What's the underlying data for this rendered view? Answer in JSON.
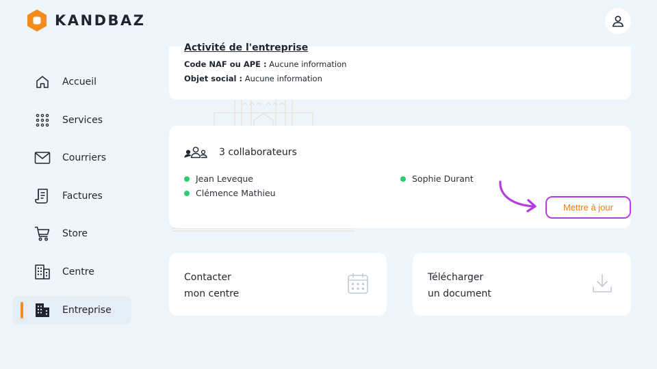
{
  "brand": {
    "name": "KANDBAZ",
    "accent_color": "#f28c1d"
  },
  "header": {
    "account_icon": "user-icon"
  },
  "sidebar": {
    "items": [
      {
        "label": "Accueil",
        "icon": "home-icon",
        "active": false
      },
      {
        "label": "Services",
        "icon": "grid-dots-icon",
        "active": false
      },
      {
        "label": "Courriers",
        "icon": "envelope-icon",
        "active": false
      },
      {
        "label": "Factures",
        "icon": "invoice-icon",
        "active": false
      },
      {
        "label": "Store",
        "icon": "cart-icon",
        "active": false
      },
      {
        "label": "Centre",
        "icon": "building-icon",
        "active": false
      },
      {
        "label": "Entreprise",
        "icon": "enterprise-icon",
        "active": true
      }
    ]
  },
  "activity": {
    "title": "Activité de l'entreprise",
    "naf_label": "Code NAF ou APE :",
    "naf_value": "Aucune information",
    "object_label": "Objet social :",
    "object_value": "Aucune information"
  },
  "collaborators": {
    "title": "3 collaborateurs",
    "members": [
      "Jean Leveque",
      "Clémence Mathieu",
      "Sophie Durant"
    ],
    "status_color": "#2ecc71",
    "update_label": "Mettre à jour",
    "highlight_color": "#b53ce0"
  },
  "actions": {
    "contact": {
      "line1": "Contacter",
      "line2": "mon centre",
      "icon": "calendar-icon"
    },
    "download": {
      "line1": "Télécharger",
      "line2": "un document",
      "icon": "download-icon"
    }
  }
}
